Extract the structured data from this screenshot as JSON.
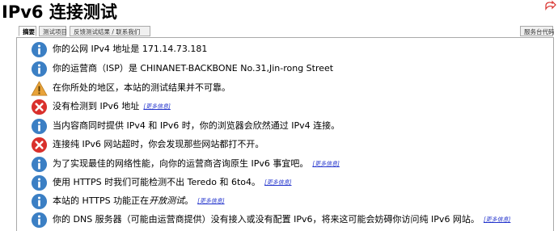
{
  "page": {
    "title": "IPv6 连接测试"
  },
  "tabs": [
    {
      "label": "摘要",
      "active": true
    },
    {
      "label": "测试项目",
      "active": false
    },
    {
      "label": "反馈测试结果 / 联系我们",
      "active": false
    },
    {
      "label": "服务台代码",
      "active": false
    }
  ],
  "colors": {
    "info": "#3b7fc4",
    "warning": "#e8a33a",
    "error": "#d9302c",
    "link": "#2233cc"
  },
  "results": [
    {
      "icon": "info-icon",
      "text": "你的公网 IPv4 地址是 171.14.73.181",
      "more": ""
    },
    {
      "icon": "info-icon",
      "text": "你的运营商（ISP）是 CHINANET-BACKBONE No.31,Jin-rong Street",
      "more": ""
    },
    {
      "icon": "warning-icon",
      "text": "在你所处的地区，本站的测试结果并不可靠。",
      "more": ""
    },
    {
      "icon": "error-icon",
      "text": "没有检测到 IPv6 地址",
      "more": "[更多信息]"
    },
    {
      "icon": "info-icon",
      "text": "当内容商同时提供 IPv4 和 IPv6 时，你的浏览器会欣然通过 IPv4 连接。",
      "more": ""
    },
    {
      "icon": "error-icon",
      "text": "连接纯 IPv6 网站超时，你会发现那些网站都打不开。",
      "more": ""
    },
    {
      "icon": "info-icon",
      "text": "为了实现最佳的网络性能，向你的运营商咨询原生 IPv6 事宜吧。",
      "more": "[更多信息]"
    },
    {
      "icon": "info-icon",
      "text": "使用 HTTPS 时我们可能检测不出 Teredo 和 6to4。",
      "more": "[更多信息]"
    },
    {
      "icon": "info-icon",
      "text_prefix": "本站的 HTTPS 功能正在",
      "text_em": "开放测试",
      "text_suffix": "。",
      "more": "[更多信息]"
    },
    {
      "icon": "info-icon",
      "text": "你的 DNS 服务器（可能由运营商提供）没有接入或没有配置 IPv6，将来这可能会妨碍你访问纯 IPv6 网站。",
      "more": "[更多信息]"
    }
  ]
}
